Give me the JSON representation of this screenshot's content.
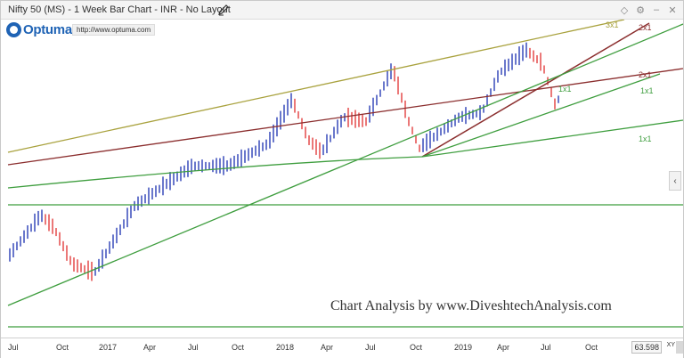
{
  "window": {
    "title": "Nifty 50 (MS) - 1 Week Bar Chart - INR - No Layout",
    "controls": [
      "diamond-icon",
      "gear-icon",
      "minimize-icon",
      "close-icon"
    ]
  },
  "branding": {
    "logo_text": "Optuma",
    "url": "http://www.optuma.com"
  },
  "chart": {
    "watermark": "Chart Analysis by www.DiveshtechAnalysis.com",
    "line_labels": {
      "l3x1": "3x1",
      "l2x1_top": "2x1",
      "l2x1_mid": "2x1",
      "l1x1_a": "1x1",
      "l1x1_b": "1x1",
      "l1x1_c": "1x1"
    },
    "colors": {
      "up_bar": "#1a2fb0",
      "down_bar": "#e03030",
      "line_3x1": "#a9a23e",
      "line_2x1": "#8b2e2e",
      "line_1x1": "#3f9e3f"
    }
  },
  "x_axis": {
    "ticks": [
      "Jul",
      "Oct",
      "2017",
      "Apr",
      "Jul",
      "Oct",
      "2018",
      "Apr",
      "Jul",
      "Oct",
      "2019",
      "Apr",
      "Jul",
      "Oct"
    ],
    "price_readout": "63.598",
    "xy_label": "XY"
  }
}
